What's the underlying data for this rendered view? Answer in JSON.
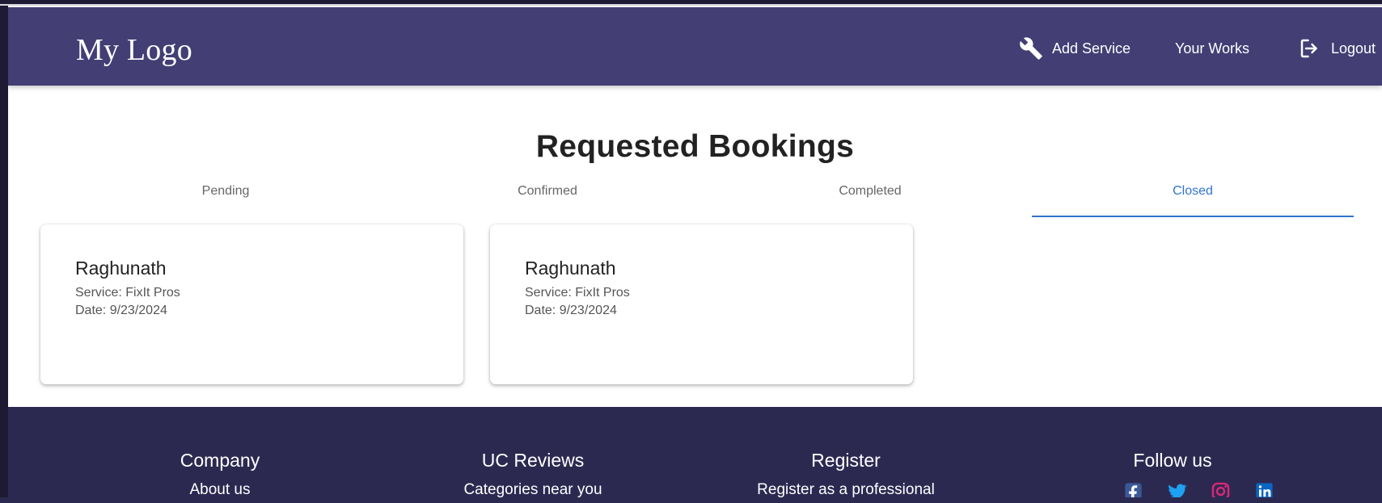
{
  "header": {
    "logo": "My Logo",
    "nav": [
      {
        "label": "Add Service",
        "icon": "wrench-icon"
      },
      {
        "label": "Your Works"
      },
      {
        "label": "Logout",
        "icon": "logout-icon"
      }
    ]
  },
  "page": {
    "title": "Requested Bookings",
    "tabs": [
      {
        "label": "Pending"
      },
      {
        "label": "Confirmed"
      },
      {
        "label": "Completed"
      },
      {
        "label": "Closed",
        "active": true
      }
    ]
  },
  "bookings": [
    {
      "name": "Raghunath",
      "service": "Service: FixIt Pros",
      "date": "Date: 9/23/2024"
    },
    {
      "name": "Raghunath",
      "service": "Service: FixIt Pros",
      "date": "Date: 9/23/2024"
    }
  ],
  "footer": {
    "columns": [
      {
        "title": "Company",
        "link": "About us"
      },
      {
        "title": "UC Reviews",
        "link": "Categories near you"
      },
      {
        "title": "Register",
        "link": "Register as a professional"
      },
      {
        "title": "Follow us"
      }
    ],
    "socials": [
      {
        "name": "facebook-icon",
        "color": "#3b5998"
      },
      {
        "name": "twitter-icon",
        "color": "#1da1f2"
      },
      {
        "name": "instagram-icon",
        "color": "#d62976"
      },
      {
        "name": "linkedin-icon",
        "color": "#0a66c2"
      }
    ]
  },
  "colors": {
    "header": "#433e74",
    "footer": "#2c2951",
    "active_tab": "#2f74cf",
    "background": "#1f1a33"
  }
}
